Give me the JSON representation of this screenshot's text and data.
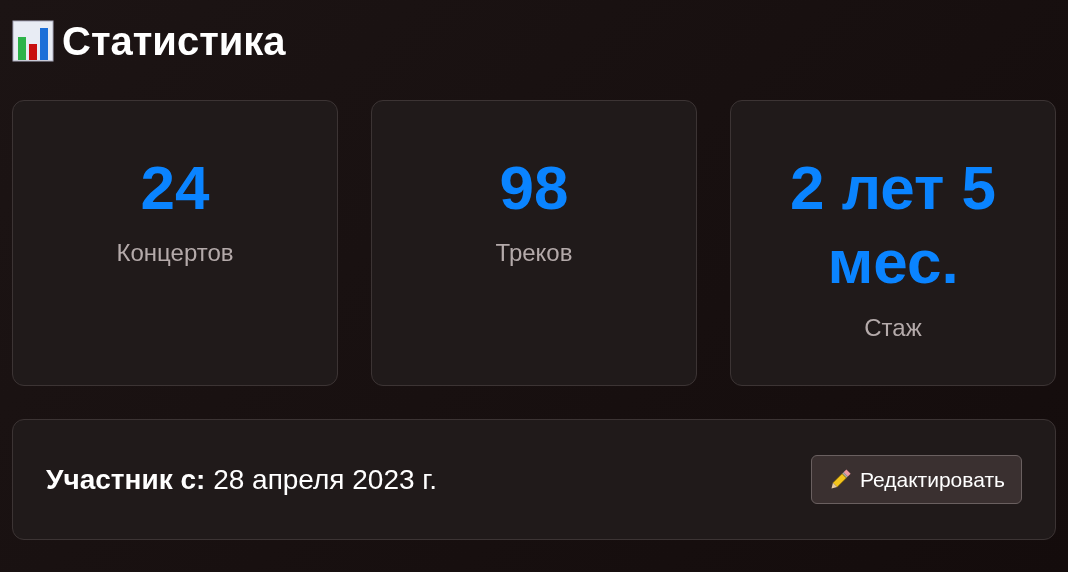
{
  "title": "Статистика",
  "stats": [
    {
      "value": "24",
      "label": "Концертов"
    },
    {
      "value": "98",
      "label": "Треков"
    },
    {
      "value": "2 лет 5 мес.",
      "label": "Стаж"
    }
  ],
  "member": {
    "label": "Участник с:",
    "date": "28 апреля 2023 г."
  },
  "edit_button": "Редактировать"
}
